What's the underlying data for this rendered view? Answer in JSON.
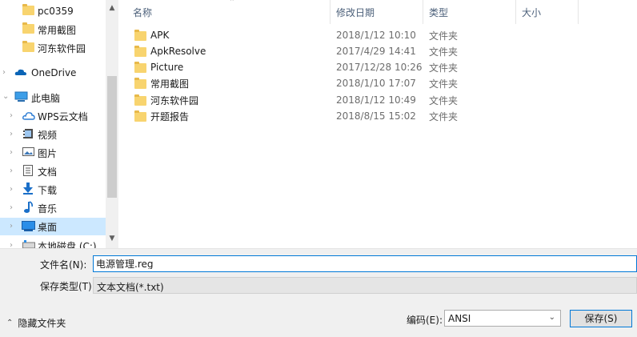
{
  "nav": {
    "items": [
      {
        "label": "pc0359",
        "icon": "folder-icon",
        "chevron": false
      },
      {
        "label": "常用截图",
        "icon": "folder-icon",
        "chevron": false
      },
      {
        "label": "河东软件园",
        "icon": "folder-icon",
        "chevron": false
      },
      {
        "label": "OneDrive",
        "icon": "cloud-icon",
        "chevron": true
      },
      {
        "label": "此电脑",
        "icon": "computer-icon",
        "chevron": true,
        "expanded": true
      },
      {
        "label": "WPS云文档",
        "icon": "wps-cloud-icon",
        "chevron": true
      },
      {
        "label": "视频",
        "icon": "video-icon",
        "chevron": true
      },
      {
        "label": "图片",
        "icon": "pictures-icon",
        "chevron": true
      },
      {
        "label": "文档",
        "icon": "documents-icon",
        "chevron": true
      },
      {
        "label": "下载",
        "icon": "download-icon",
        "chevron": true
      },
      {
        "label": "音乐",
        "icon": "music-icon",
        "chevron": true
      },
      {
        "label": "桌面",
        "icon": "desktop-icon",
        "chevron": true,
        "selected": true
      },
      {
        "label": "本地磁盘 (C:)",
        "icon": "drive-icon",
        "chevron": true
      }
    ]
  },
  "columns": {
    "name": "名称",
    "date": "修改日期",
    "type": "类型",
    "size": "大小"
  },
  "files": [
    {
      "name": "APK",
      "date": "2018/1/12 10:10",
      "type": "文件夹"
    },
    {
      "name": "ApkResolve",
      "date": "2017/4/29 14:41",
      "type": "文件夹"
    },
    {
      "name": "Picture",
      "date": "2017/12/28 10:26",
      "type": "文件夹"
    },
    {
      "name": "常用截图",
      "date": "2018/1/10 17:07",
      "type": "文件夹"
    },
    {
      "name": "河东软件园",
      "date": "2018/1/12 10:49",
      "type": "文件夹"
    },
    {
      "name": "开题报告",
      "date": "2018/8/15 15:02",
      "type": "文件夹"
    }
  ],
  "form": {
    "filename_label": "文件名(N):",
    "filename_value": "电源管理.reg",
    "filetype_label": "保存类型(T):",
    "filetype_value": "文本文档(*.txt)",
    "encoding_label": "编码(E):",
    "encoding_value": "ANSI",
    "save_label": "保存(S)",
    "hide_folders_label": "隐藏文件夹"
  },
  "colors": {
    "accent": "#0078d7",
    "selected_bg": "#cce8ff",
    "folder": "#f8d46f"
  }
}
